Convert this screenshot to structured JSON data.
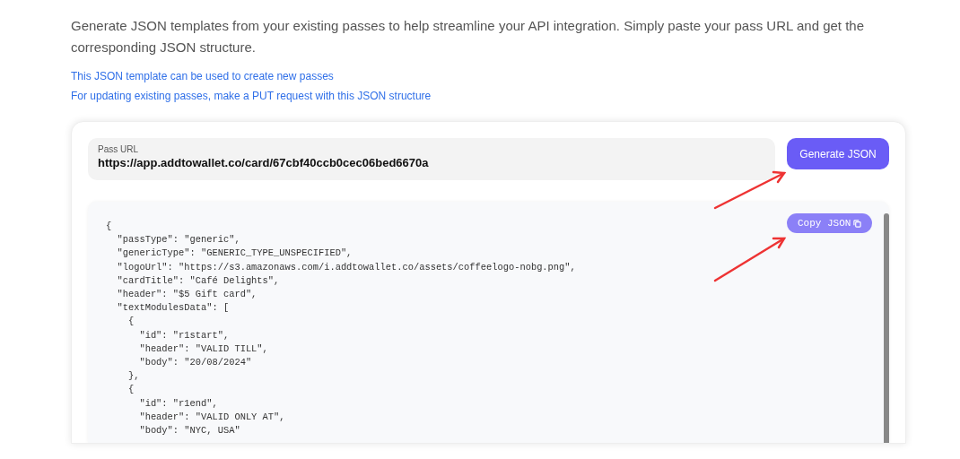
{
  "intro": "Generate JSON templates from your existing passes to help streamline your API integration. Simply paste your pass URL and get the corresponding JSON structure.",
  "notes": [
    "This JSON template can be used to create new passes",
    "For updating existing passes, make a PUT request with this JSON structure"
  ],
  "pass_url": {
    "label": "Pass URL",
    "value": "https://app.addtowallet.co/card/67cbf40ccb0cec06bed6670a"
  },
  "generate_button": "Generate JSON",
  "copy_button": "Copy JSON",
  "code": "{\n  \"passType\": \"generic\",\n  \"genericType\": \"GENERIC_TYPE_UNSPECIFIED\",\n  \"logoUrl\": \"https://s3.amazonaws.com/i.addtowallet.co/assets/coffeelogo-nobg.png\",\n  \"cardTitle\": \"Café Delights\",\n  \"header\": \"$5 Gift card\",\n  \"textModulesData\": [\n    {\n      \"id\": \"r1start\",\n      \"header\": \"VALID TILL\",\n      \"body\": \"20/08/2024\"\n    },\n    {\n      \"id\": \"r1end\",\n      \"header\": \"VALID ONLY AT\",\n      \"body\": \"NYC, USA\""
}
